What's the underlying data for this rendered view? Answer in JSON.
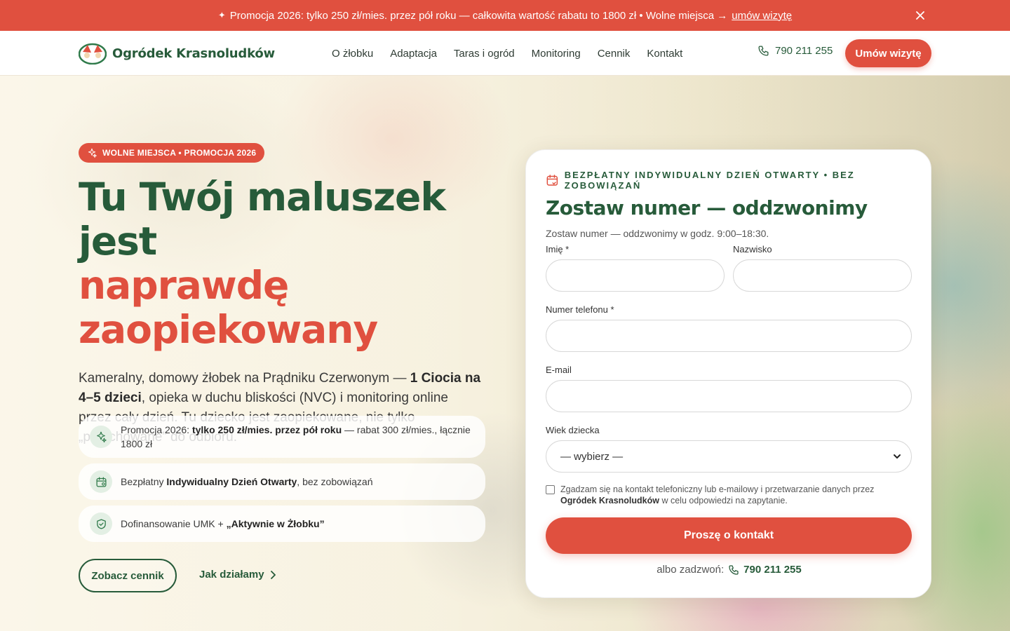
{
  "promo_bar": {
    "icon": "sparkle-icon",
    "text": "Promocja 2026: tylko 250 zł/mies. przez pół roku — całkowita wartość rabatu to 1800 zł • Wolne miejsca →",
    "link": "umów wizytę",
    "close_icon": "close-icon"
  },
  "header": {
    "brand": "Ogródek Krasnoludków",
    "nav": [
      "O żłobku",
      "Adaptacja",
      "Taras i ogród",
      "Monitoring",
      "Cennik",
      "Kontakt"
    ],
    "phone": "790 211 255",
    "cta": "Umów wizytę"
  },
  "hero": {
    "badge": "WOLNE MIEJSCA • PROMOCJA 2026",
    "title_line1": "Tu Twój maluszek jest",
    "title_line2": "naprawdę",
    "title_line3": "zaopiekowany",
    "lead_start": "Kameralny, domowy żłobek na Prądniku Czerwonym — ",
    "lead_bold": "1 Ciocia na 4–5 dzieci",
    "lead_end": ", opieka w duchu bliskości (NVC) i monitoring online przez cały dzień. Tu dziecko jest zaopiekowane, nie tylko „przechowane” do odbioru.",
    "features": [
      {
        "icon": "sparkle-icon",
        "pre": "Promocja 2026: ",
        "bold": "tylko 250 zł/mies. przez pół roku",
        "post": " — rabat 300 zł/mies., łącznie 1800 zł"
      },
      {
        "icon": "calendar-icon",
        "pre": "Bezpłatny ",
        "bold": "Indywidualny Dzień Otwarty",
        "post": ", bez zobowiązań"
      },
      {
        "icon": "shield-check-icon",
        "pre": "Dofinansowanie UMK + ",
        "bold": "„Aktywnie w Żłobku”",
        "post": ""
      }
    ],
    "btn_pricing": "Zobacz cennik",
    "link_how": "Jak działamy"
  },
  "form": {
    "kicker": "BEZPŁATNY INDYWIDUALNY DZIEŃ OTWARTY • BEZ ZOBOWIĄZAŃ",
    "title": "Zostaw numer — oddzwonimy",
    "subtitle": "Zostaw numer — oddzwonimy w godz. 9:00–18:30.",
    "first_name_label": "Imię *",
    "first_name_value": "",
    "last_name_label": "Nazwisko",
    "last_name_value": "",
    "phone_label": "Numer telefonu *",
    "phone_value": "",
    "email_label": "E-mail",
    "email_value": "",
    "age_label": "Wiek dziecka",
    "age_selected": "— wybierz —",
    "consent_pre": "Zgadzam się na kontakt telefoniczny lub e-mailowy i przetwarzanie danych przez ",
    "consent_bold": "Ogródek Krasnoludków",
    "consent_post": " w celu odpowiedzi na zapytanie.",
    "consent_checked": false,
    "submit": "Proszę o kontakt",
    "alt_text": "albo zadzwoń:",
    "alt_phone": "790 211 255"
  },
  "colors": {
    "brand_green": "#275b3a",
    "accent_red": "#e0503f"
  }
}
